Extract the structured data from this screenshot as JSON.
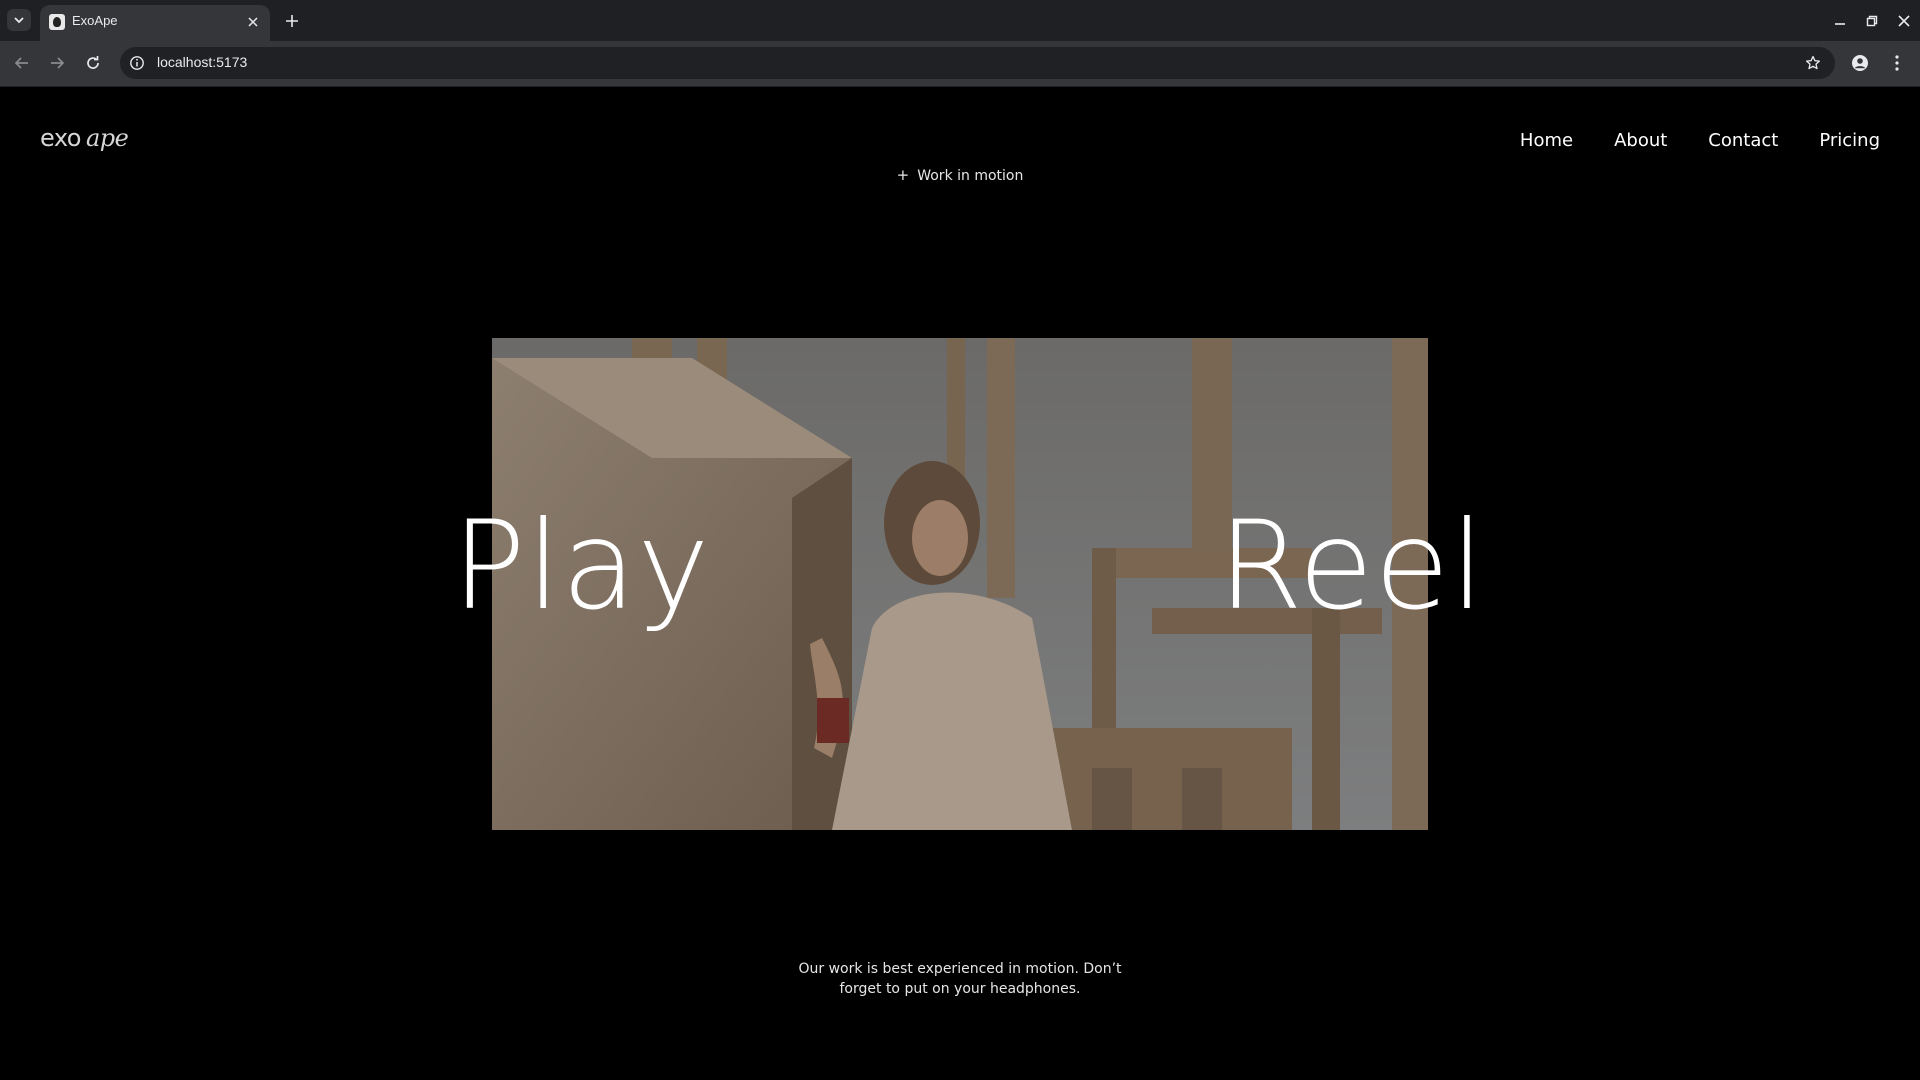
{
  "browser": {
    "tab_title": "ExoApe",
    "url": "localhost:5173",
    "icons": {
      "tab_list": "chevron-down-icon",
      "close_tab": "close-icon",
      "new_tab": "plus-icon",
      "back": "arrow-left-icon",
      "forward": "arrow-right-icon",
      "reload": "reload-icon",
      "site_info": "info-icon",
      "bookmark": "star-icon",
      "profile": "person-icon",
      "menu": "kebab-menu-icon",
      "minimize": "minimize-icon",
      "restore": "restore-icon",
      "close_window": "close-icon"
    }
  },
  "site": {
    "logo_exo": "exo",
    "logo_ape": "ape",
    "nav": [
      {
        "label": "Home"
      },
      {
        "label": "About"
      },
      {
        "label": "Contact"
      },
      {
        "label": "Pricing"
      }
    ],
    "eyebrow_plus": "+",
    "eyebrow": "Work in motion",
    "hero_left": "Play",
    "hero_right": "Reel",
    "caption_line1": "Our work is best experienced in motion. Don’t",
    "caption_line2": "forget to put on your headphones."
  },
  "colors": {
    "page_bg": "#000000",
    "chrome_dark": "#1f2023",
    "chrome_toolbar": "#35363a",
    "omnibox": "#202124",
    "text": "#ffffff"
  }
}
